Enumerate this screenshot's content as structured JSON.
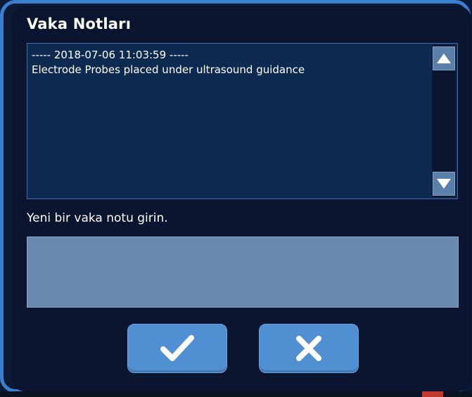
{
  "dialog": {
    "title": "Vaka Notları",
    "notes": {
      "lines": [
        "----- 2018-07-06 11:03:59 -----",
        "Electrode Probes placed under ultrasound guidance"
      ]
    },
    "scrollbar": {
      "up_icon": "triangle-up-icon",
      "down_icon": "triangle-down-icon"
    },
    "prompt": "Yeni bir vaka notu girin.",
    "input": {
      "value": "",
      "placeholder": ""
    },
    "buttons": {
      "confirm_icon": "checkmark-icon",
      "cancel_icon": "close-x-icon"
    }
  },
  "colors": {
    "frame_border": "#3b7fd0",
    "dialog_bg": "#0b1530",
    "notes_bg": "#0f2a50",
    "input_bg": "#6888ad",
    "button_bg": "#4f8fd2",
    "text": "#ffffff"
  }
}
